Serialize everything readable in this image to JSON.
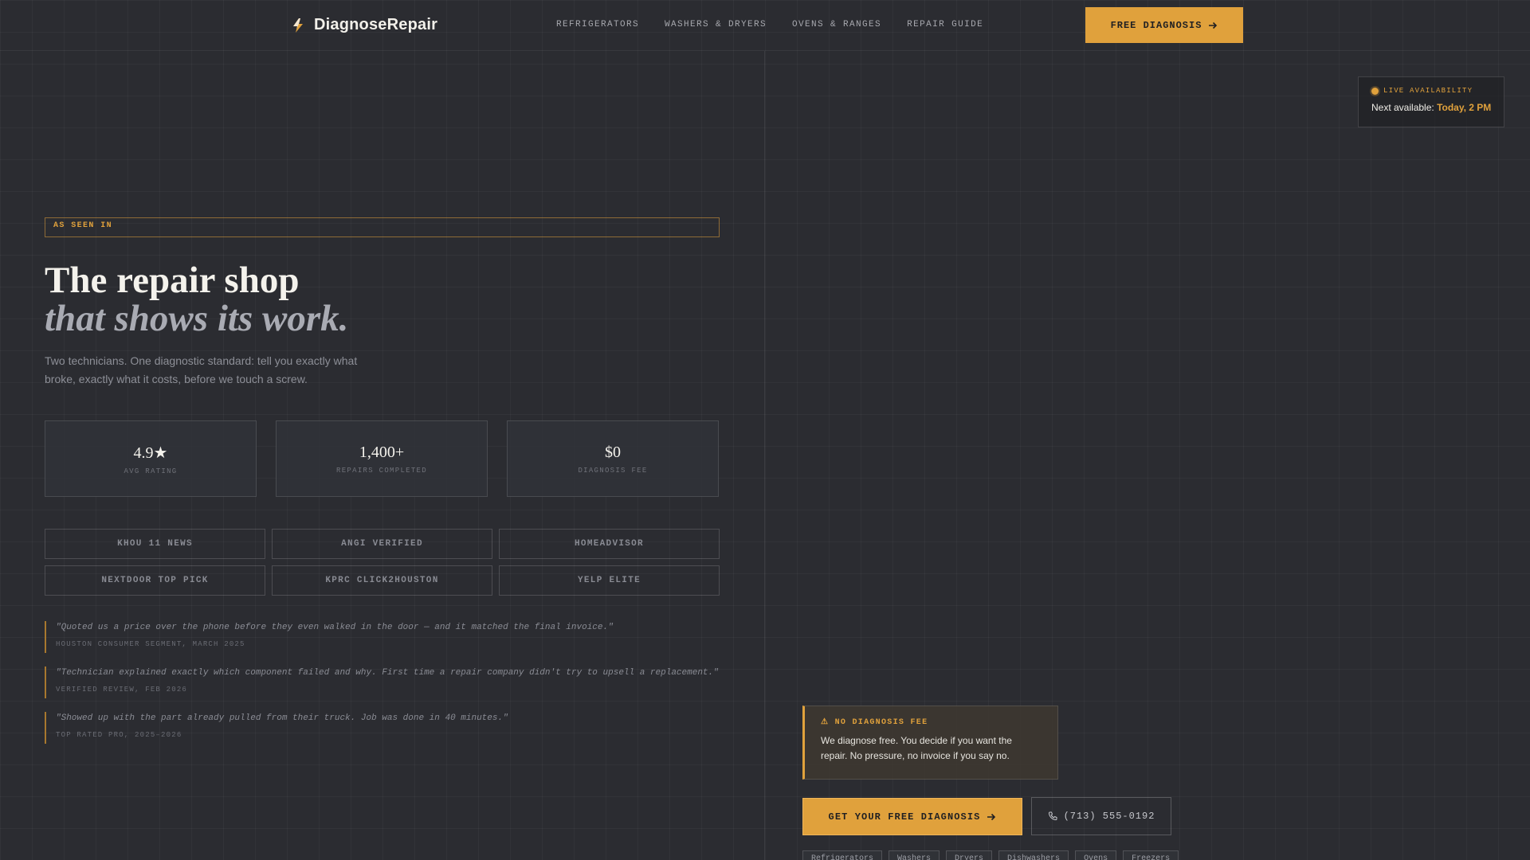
{
  "header": {
    "brand": "DiagnoseRepair",
    "nav": [
      "REFRIGERATORS",
      "WASHERS & DRYERS",
      "OVENS & RANGES",
      "REPAIR GUIDE"
    ],
    "cta_label": "FREE DIAGNOSIS"
  },
  "availability": {
    "label": "LIVE AVAILABILITY",
    "prefix": "Next available:",
    "value": "Today, 2 PM"
  },
  "hero": {
    "badge": "AS SEEN IN",
    "headline_line1": "The repair shop",
    "headline_line2": "that shows its work.",
    "subtext": "Two technicians. One diagnostic standard: tell you exactly what broke, exactly what it costs, before we touch a screw."
  },
  "stats": [
    {
      "value": "4.9★",
      "label": "AVG RATING"
    },
    {
      "value": "1,400+",
      "label": "REPAIRS COMPLETED"
    },
    {
      "value": "$0",
      "label": "DIAGNOSIS FEE"
    }
  ],
  "press": [
    "KHOU 11 NEWS",
    "ANGI VERIFIED",
    "HOMEADVISOR",
    "NEXTDOOR TOP PICK",
    "KPRC CLICK2HOUSTON",
    "YELP ELITE"
  ],
  "testimonials": [
    {
      "quote": "\"Quoted us a price over the phone before they even walked in the door — and it matched the final invoice.\"",
      "source": "HOUSTON CONSUMER SEGMENT, MARCH 2025"
    },
    {
      "quote": "\"Technician explained exactly which component failed and why. First time a repair company didn't try to upsell a replacement.\"",
      "source": "VERIFIED REVIEW, FEB 2026"
    },
    {
      "quote": "\"Showed up with the part already pulled from their truck. Job was done in 40 minutes.\"",
      "source": "TOP RATED PRO, 2025–2026"
    }
  ],
  "no_fee": {
    "title": "⚠ NO DIAGNOSIS FEE",
    "text": "We diagnose free. You decide if you want the repair. No pressure, no invoice if you say no."
  },
  "cta": {
    "main_label": "GET YOUR FREE DIAGNOSIS",
    "phone": "(713) 555-0192"
  },
  "chips": [
    "Refrigerators",
    "Washers",
    "Dryers",
    "Dishwashers",
    "Ovens",
    "Freezers"
  ],
  "colors": {
    "accent": "#e0a13c",
    "background": "#2b2c31"
  }
}
